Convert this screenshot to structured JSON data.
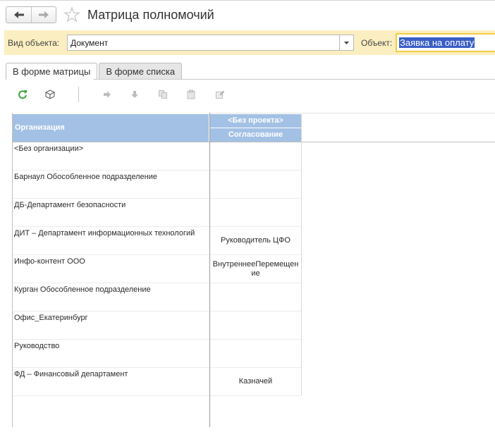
{
  "header": {
    "title": "Матрица полномочий",
    "back_icon": "arrow-left-icon",
    "forward_icon": "arrow-right-icon",
    "favorite_icon": "star-icon"
  },
  "filters": {
    "kind_label": "Вид объекта:",
    "kind_value": "Документ",
    "object_label": "Объект:",
    "object_value": "Заявка на оплату"
  },
  "tabs": [
    {
      "label": "В форме матрицы",
      "active": true
    },
    {
      "label": "В форме списка",
      "active": false
    }
  ],
  "toolbar": {
    "icons": [
      "refresh-icon",
      "cube-icon",
      "arrow-right-icon",
      "arrow-down-icon",
      "copy-icon",
      "paste-icon",
      "edit-icon"
    ]
  },
  "grid": {
    "org_header": "Организация",
    "project_header": "<Без проекта>",
    "stage_header": "Согласование",
    "rows": [
      {
        "org": "<Без организации>",
        "value": ""
      },
      {
        "org": "Барнаул Обособленное подразделение",
        "value": ""
      },
      {
        "org": "ДБ-Департамент безопасности",
        "value": ""
      },
      {
        "org": "ДИТ – Департамент информационных технологий",
        "value": "Руководитель ЦФО"
      },
      {
        "org": "Инфо-контент ООО",
        "value": "ВнутреннееПеремещение"
      },
      {
        "org": "Курган Обособленное подразделение",
        "value": ""
      },
      {
        "org": "Офис_Екатеринбург",
        "value": ""
      },
      {
        "org": "Руководство",
        "value": ""
      },
      {
        "org": "ФД – Финансовый департамент",
        "value": "Казначей"
      }
    ]
  },
  "colors": {
    "filter_bar_bg": "#fbeec0",
    "header_bg": "#a3c1e4",
    "selection": "#3a5ec5",
    "focus_border": "#f2cc41",
    "refresh": "#3aa53a"
  }
}
